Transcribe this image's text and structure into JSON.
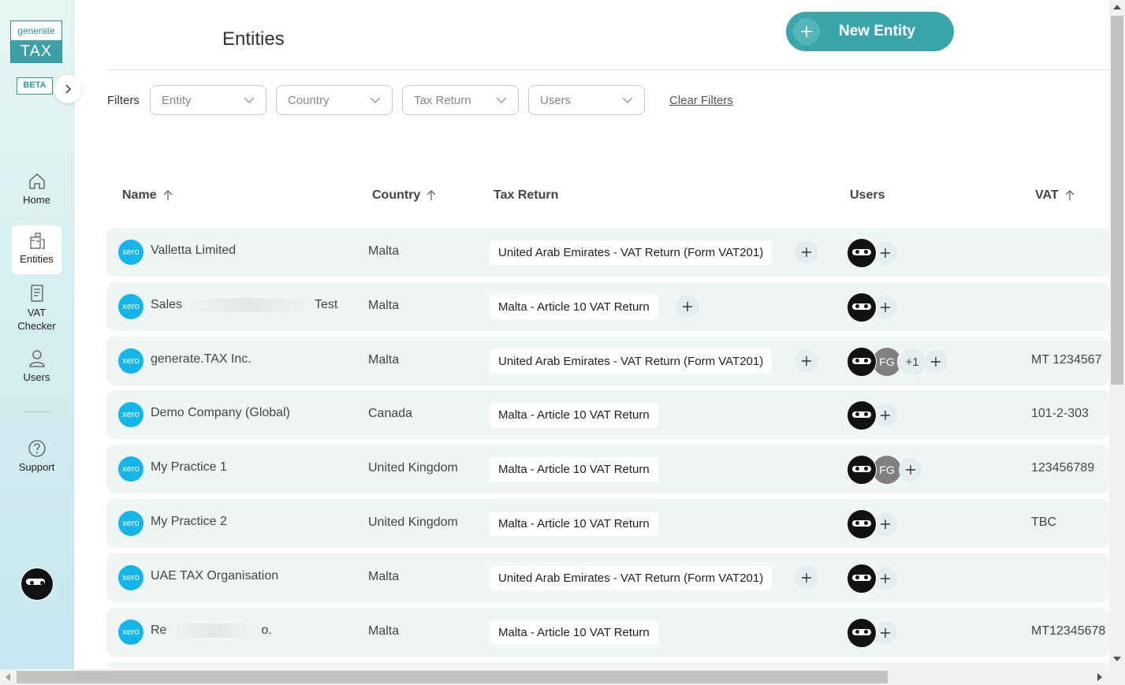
{
  "brand": {
    "logo_top": "generate",
    "logo_bottom": "TAX",
    "beta": "BETA"
  },
  "nav": [
    {
      "label": "Home",
      "icon": "home-icon"
    },
    {
      "label": "Entities",
      "icon": "building-icon",
      "active": true
    },
    {
      "label": "VAT Checker",
      "icon": "document-icon"
    },
    {
      "label": "Users",
      "icon": "user-icon"
    },
    {
      "label": "Support",
      "icon": "help-icon"
    }
  ],
  "header": {
    "title": "Entities",
    "new_button": "New Entity"
  },
  "filters": {
    "label": "Filters",
    "entity": "Entity",
    "country": "Country",
    "tax_return": "Tax Return",
    "users": "Users",
    "clear": "Clear Filters"
  },
  "columns": {
    "name": "Name",
    "country": "Country",
    "tax_return": "Tax Return",
    "users": "Users",
    "vat": "VAT"
  },
  "rows": [
    {
      "badge": "xero",
      "name": "Valletta Limited",
      "country": "Malta",
      "tax_return": "United Arab Emirates - VAT Return (Form VAT201)",
      "vat": ""
    },
    {
      "badge": "xero",
      "name_start": "Sales",
      "name_end": "Test",
      "country": "Malta",
      "tax_return": "Malta - Article 10 VAT Return",
      "vat": ""
    },
    {
      "badge": "xero",
      "name": "generate.TAX Inc.",
      "country": "Malta",
      "tax_return": "United Arab Emirates - VAT Return (Form VAT201)",
      "users_initials": "FG",
      "users_more": "+1",
      "vat": "MT 1234567"
    },
    {
      "badge": "xero",
      "name": "Demo Company (Global)",
      "country": "Canada",
      "tax_return": "Malta - Article 10 VAT Return",
      "vat": "101-2-303"
    },
    {
      "badge": "xero",
      "name": "My Practice 1",
      "country": "United Kingdom",
      "tax_return": "Malta - Article 10 VAT Return",
      "users_initials": "FG",
      "vat": "123456789"
    },
    {
      "badge": "xero",
      "name": "My Practice 2",
      "country": "United Kingdom",
      "tax_return": "Malta - Article 10 VAT Return",
      "vat": "TBC"
    },
    {
      "badge": "xero",
      "name": "UAE TAX Organisation",
      "country": "Malta",
      "tax_return": "United Arab Emirates - VAT Return (Form VAT201)",
      "vat": ""
    },
    {
      "badge": "xero",
      "name_start": "Re",
      "name_end": "o.",
      "country": "Malta",
      "tax_return": "Malta - Article 10 VAT Return",
      "vat": "MT12345678"
    }
  ],
  "colors": {
    "accent": "#3aa6ab",
    "xero": "#13b5ea",
    "row_bg": "#f0f5f6"
  }
}
